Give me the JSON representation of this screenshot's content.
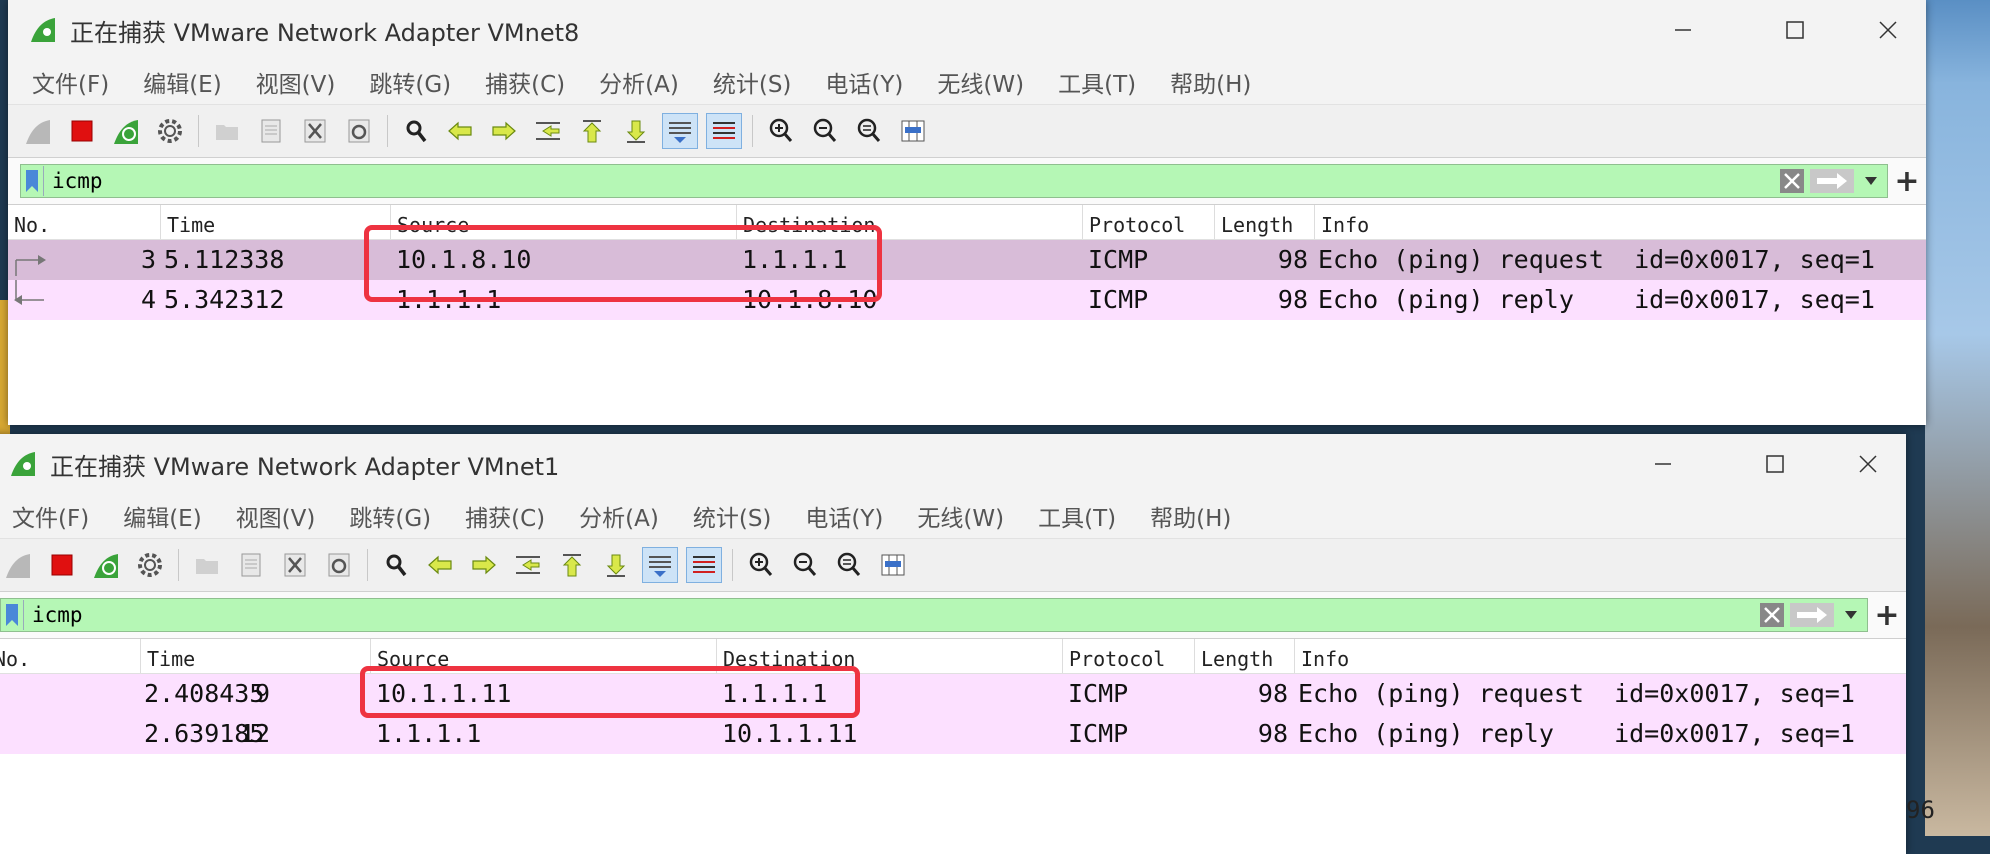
{
  "window1": {
    "title": "正在捕获 VMware Network Adapter VMnet8",
    "menu": [
      "文件(F)",
      "编辑(E)",
      "视图(V)",
      "跳转(G)",
      "捕获(C)",
      "分析(A)",
      "统计(S)",
      "电话(Y)",
      "无线(W)",
      "工具(T)",
      "帮助(H)"
    ],
    "filter": "icmp",
    "columns": [
      "No.",
      "Time",
      "Source",
      "Destination",
      "Protocol",
      "Length",
      "Info"
    ],
    "rows": [
      {
        "no": "3",
        "time": "5.112338",
        "source": "10.1.8.10",
        "destination": "1.1.1.1",
        "protocol": "ICMP",
        "length": "98",
        "info": "Echo (ping) request  id=0x0017, seq=1"
      },
      {
        "no": "4",
        "time": "5.342312",
        "source": "1.1.1.1",
        "destination": "10.1.8.10",
        "protocol": "ICMP",
        "length": "98",
        "info": "Echo (ping) reply    id=0x0017, seq=1"
      }
    ]
  },
  "window2": {
    "title": "正在捕获 VMware Network Adapter VMnet1",
    "menu": [
      "文件(F)",
      "编辑(E)",
      "视图(V)",
      "跳转(G)",
      "捕获(C)",
      "分析(A)",
      "统计(S)",
      "电话(Y)",
      "无线(W)",
      "工具(T)",
      "帮助(H)"
    ],
    "filter": "icmp",
    "columns": [
      "No.",
      "Time",
      "Source",
      "Destination",
      "Protocol",
      "Length",
      "Info"
    ],
    "rows": [
      {
        "no": "9",
        "time": "2.408435",
        "source": "10.1.1.11",
        "destination": "1.1.1.1",
        "protocol": "ICMP",
        "length": "98",
        "info": "Echo (ping) request  id=0x0017, seq=1"
      },
      {
        "no": "12",
        "time": "2.639185",
        "source": "1.1.1.1",
        "destination": "10.1.1.11",
        "protocol": "ICMP",
        "length": "98",
        "info": "Echo (ping) reply    id=0x0017, seq=1"
      }
    ]
  },
  "colors": {
    "filter_bg": "#b5f7b5",
    "row_selected": "#d8bcd8",
    "row_icmp": "#fce0ff",
    "highlight": "#ee3341"
  },
  "icons": {
    "toolbar": [
      "shark-fin-icon",
      "stop-icon",
      "restart-icon",
      "options-gear-icon",
      "open-folder-icon",
      "save-icon",
      "close-file-icon",
      "reload-icon",
      "find-icon",
      "back-icon",
      "forward-icon",
      "goto-packet-icon",
      "first-packet-icon",
      "last-packet-icon",
      "autoscroll-icon",
      "colorize-icon",
      "zoom-in-icon",
      "zoom-out-icon",
      "zoom-reset-icon",
      "resize-columns-icon"
    ]
  },
  "edge_text": "96"
}
